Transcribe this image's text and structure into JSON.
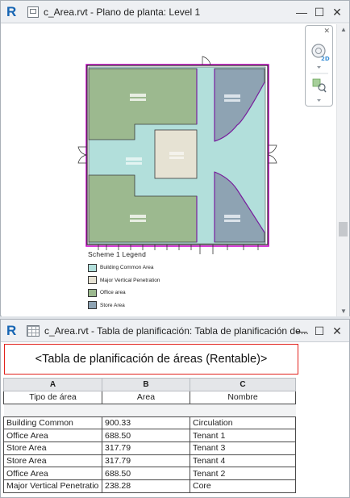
{
  "plan_window": {
    "title": "c_Area.rvt - Plano de planta: Level 1",
    "legend": {
      "title": "Scheme 1 Legend",
      "items": [
        {
          "label": "Building Common Area",
          "color": "#b2dfdb"
        },
        {
          "label": "Major Vertical Penetration",
          "color": "#e6e2d3"
        },
        {
          "label": "Office area",
          "color": "#9cb98f"
        },
        {
          "label": "Store Area",
          "color": "#8ea3b3"
        }
      ]
    },
    "nav_badge": "2D"
  },
  "schedule_window": {
    "title": "c_Area.rvt - Tabla de planificación: Tabla de planificación de...",
    "schedule_title": "<Tabla de planificación de áreas (Rentable)>",
    "column_letters": [
      "A",
      "B",
      "C"
    ],
    "columns": [
      "Tipo de área",
      "Area",
      "Nombre"
    ],
    "rows": [
      [
        "Building Common",
        "900.33",
        "Circulation"
      ],
      [
        "Office Area",
        "688.50",
        "Tenant 1"
      ],
      [
        "Store Area",
        "317.79",
        "Tenant 3"
      ],
      [
        "Store Area",
        "317.79",
        "Tenant 4"
      ],
      [
        "Office Area",
        "688.50",
        "Tenant 2"
      ],
      [
        "Major Vertical Penetratio",
        "238.28",
        "Core"
      ]
    ]
  },
  "window_buttons": {
    "minimize": "—",
    "maximize": "☐",
    "close": "✕"
  }
}
